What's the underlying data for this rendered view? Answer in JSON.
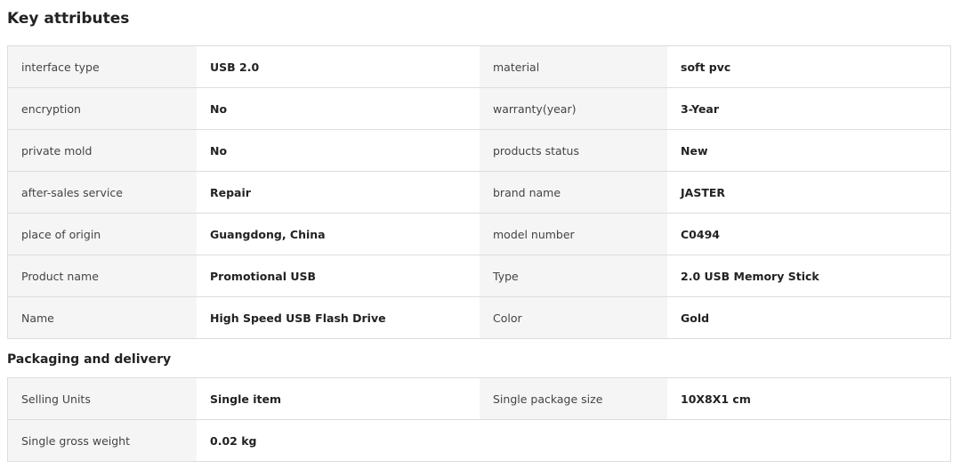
{
  "key_attributes": {
    "title": "Key attributes",
    "rows": [
      [
        {
          "label": "interface type",
          "value": "USB 2.0"
        },
        {
          "label": "material",
          "value": "soft pvc"
        }
      ],
      [
        {
          "label": "encryption",
          "value": "No"
        },
        {
          "label": "warranty(year)",
          "value": "3-Year"
        }
      ],
      [
        {
          "label": "private mold",
          "value": "No"
        },
        {
          "label": "products status",
          "value": "New"
        }
      ],
      [
        {
          "label": "after-sales service",
          "value": "Repair"
        },
        {
          "label": "brand name",
          "value": "JASTER"
        }
      ],
      [
        {
          "label": "place of origin",
          "value": "Guangdong, China"
        },
        {
          "label": "model number",
          "value": "C0494"
        }
      ],
      [
        {
          "label": "Product name",
          "value": "Promotional USB"
        },
        {
          "label": "Type",
          "value": "2.0 USB Memory Stick"
        }
      ],
      [
        {
          "label": "Name",
          "value": "High Speed USB Flash Drive"
        },
        {
          "label": "Color",
          "value": "Gold"
        }
      ]
    ]
  },
  "packaging": {
    "title": "Packaging and delivery",
    "rows": [
      [
        {
          "label": "Selling Units",
          "value": "Single item"
        },
        {
          "label": "Single package size",
          "value": "10X8X1 cm"
        }
      ],
      [
        {
          "label": "Single gross weight",
          "value": "0.02 kg"
        }
      ]
    ]
  },
  "colors": {
    "label_bg": "#f5f5f5",
    "border": "#dddddd",
    "text": "#222222"
  }
}
